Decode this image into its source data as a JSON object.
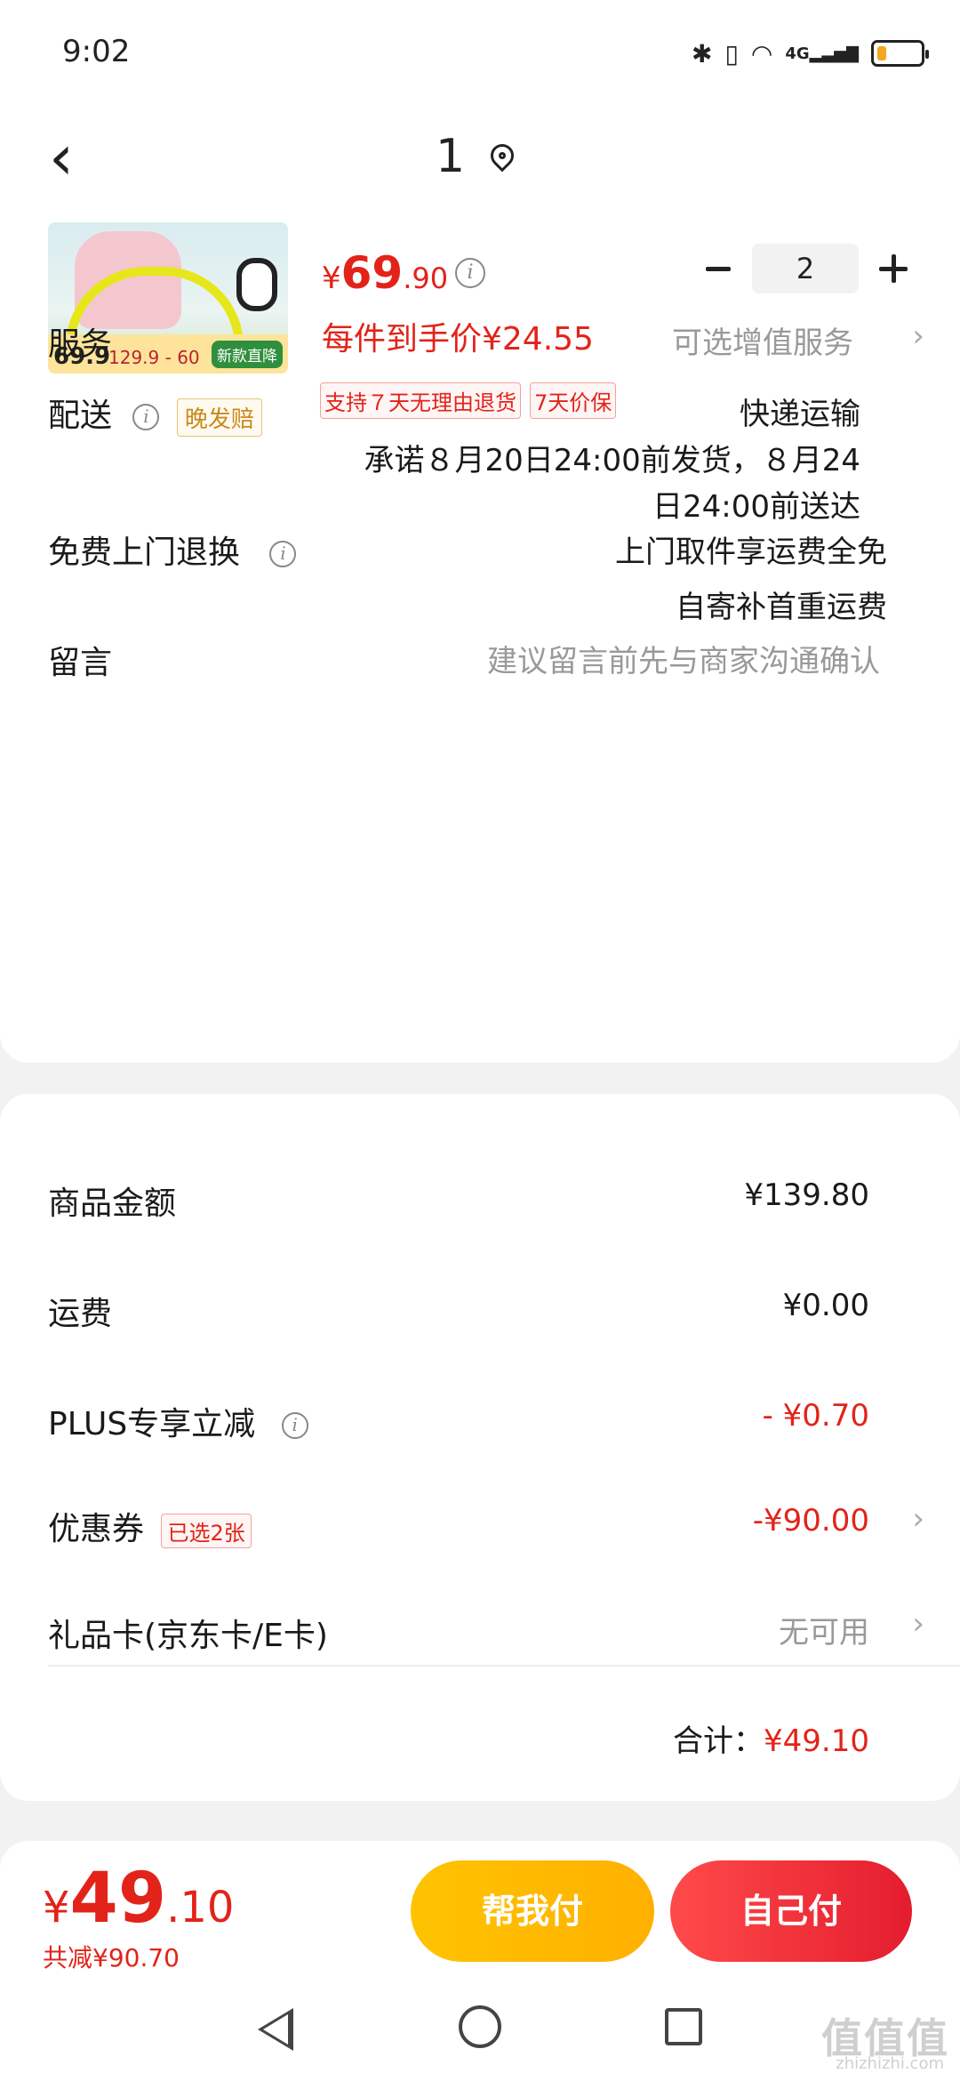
{
  "status_bar": {
    "time": "9:02",
    "icons": [
      "bluetooth-icon",
      "vibrate-icon",
      "wifi-icon",
      "signal-4g-icon",
      "battery-icon"
    ],
    "network_label": "4G",
    "battery_level": 0.2
  },
  "header": {
    "title": "1",
    "back_icon": "chevron-left-icon",
    "location_icon": "map-pin-icon"
  },
  "product": {
    "thumbnail": {
      "price_big": "69.9",
      "price_range": "129.9 - 60",
      "tag": "新款直降"
    },
    "price": {
      "currency": "¥",
      "integer": "69",
      "decimal": ".90"
    },
    "net_price": "每件到手价¥24.55",
    "tags": [
      "支持７天无理由退货",
      "7天价保"
    ],
    "quantity": "2"
  },
  "rows": {
    "service": {
      "label": "服务",
      "value": "可选增值服务"
    },
    "delivery": {
      "label": "配送",
      "badge": "晚发赔",
      "method": "快递运输",
      "promise_line1": "承诺８月20日24:00前发货，８月24",
      "promise_line2": "日24:00前送达"
    },
    "return": {
      "label": "免费上门退换",
      "line1": "上门取件享运费全免",
      "line2": "自寄补首重运费"
    },
    "message": {
      "label": "留言",
      "placeholder": "建议留言前先与商家沟通确认"
    }
  },
  "summary": {
    "goods": {
      "label": "商品金额",
      "value": "¥139.80"
    },
    "shipping": {
      "label": "运费",
      "value": "¥0.00"
    },
    "plus": {
      "label": "PLUS专享立减",
      "value": "- ¥0.70"
    },
    "coupon": {
      "label": "优惠券",
      "badge": "已选2张",
      "value": "-¥90.00"
    },
    "giftcard": {
      "label": "礼品卡(京东卡/E卡)",
      "value": "无可用"
    },
    "total_label": "合计：",
    "total_value": "¥49.10"
  },
  "bottom_bar": {
    "total": {
      "currency": "¥",
      "integer": "49",
      "decimal": ".10"
    },
    "saved": "共减¥90.70",
    "help_pay": "帮我付",
    "self_pay": "自己付"
  },
  "watermark": {
    "main": "值值值",
    "sub": "zhizhizhi.com"
  },
  "colors": {
    "accent": "#e2231a",
    "help_button": "#ffbb00",
    "self_button": "#e8262f"
  }
}
